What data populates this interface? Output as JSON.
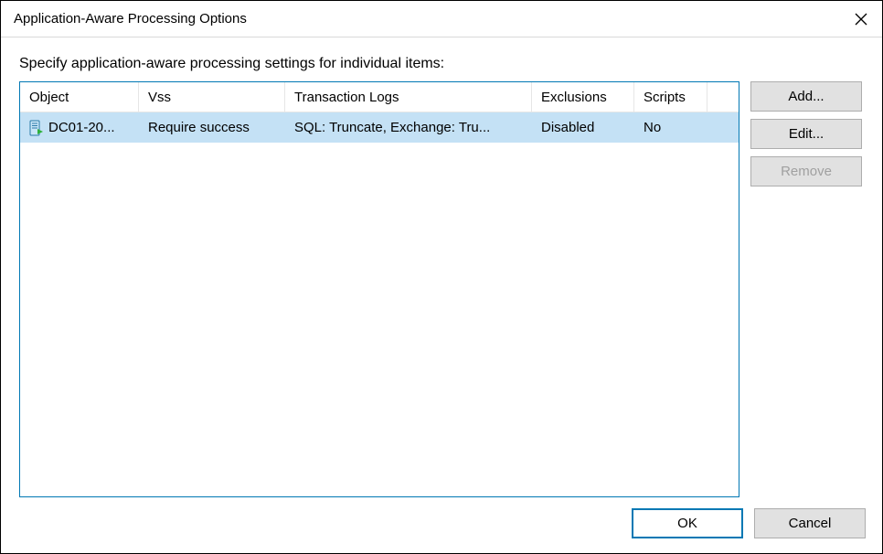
{
  "titlebar": {
    "title": "Application-Aware Processing Options"
  },
  "instruction": "Specify application-aware processing settings for individual items:",
  "table": {
    "headers": {
      "object": "Object",
      "vss": "Vss",
      "tx": "Transaction Logs",
      "excl": "Exclusions",
      "scr": "Scripts"
    },
    "rows": [
      {
        "object": "DC01-20...",
        "vss": "Require success",
        "tx": "SQL: Truncate, Exchange: Tru...",
        "excl": "Disabled",
        "scr": "No"
      }
    ]
  },
  "buttons": {
    "add": "Add...",
    "edit": "Edit...",
    "remove": "Remove",
    "ok": "OK",
    "cancel": "Cancel"
  }
}
